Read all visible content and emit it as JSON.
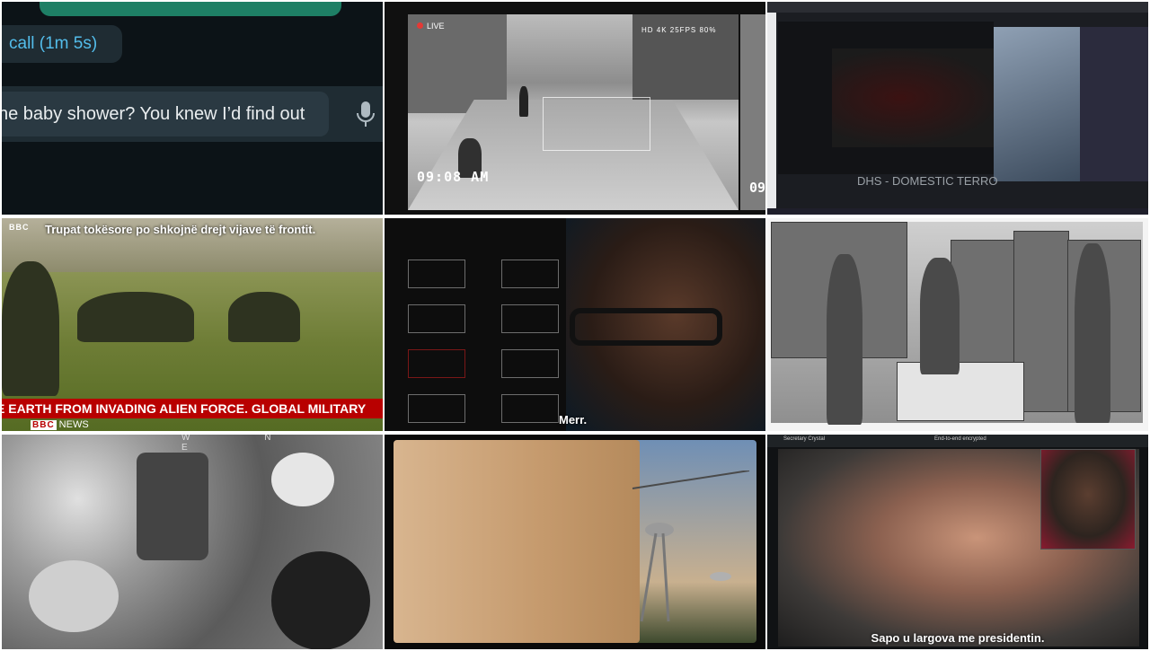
{
  "tile1": {
    "call_label": "call (1m 5s)",
    "input_text": "he baby shower? You knew I’d find out"
  },
  "tile2": {
    "rec_label": "LIVE",
    "hud": "HD  4K  25FPS  80%",
    "time": "09:08 AM",
    "time_partial": "09"
  },
  "tile3": {
    "title": "DHS - DOMESTIC TERRO"
  },
  "tile4": {
    "logo": "BBC",
    "subtitle": "Trupat tokësore po shkojnë drejt vijave të frontit.",
    "ticker": "E EARTH FROM INVADING ALIEN FORCE.  GLOBAL MILITARY",
    "news_logo": "BBC",
    "news_label": "NEWS"
  },
  "tile5": {
    "subtitle": "Merr."
  },
  "tile7": {
    "compass": "W N E"
  },
  "tile9": {
    "contact": "Secretary Crystal",
    "encryption": "End-to-end encrypted",
    "subtitle": "Sapo u largova me presidentin."
  }
}
